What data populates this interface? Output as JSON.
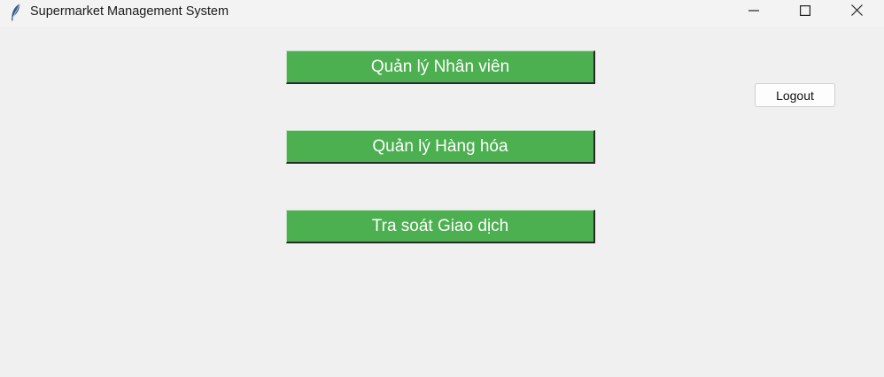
{
  "window": {
    "title": "Supermarket Management System",
    "app_icon": "feather-icon",
    "controls": [
      "minimize-icon",
      "maximize-icon",
      "close-icon"
    ]
  },
  "main": {
    "buttons": [
      {
        "label": "Quản lý Nhân viên"
      },
      {
        "label": "Quản lý Hàng hóa"
      },
      {
        "label": "Tra soát Giao dịch"
      }
    ],
    "logout_label": "Logout"
  },
  "colors": {
    "button_green": "#4caf50",
    "button_text": "#ffffff",
    "background": "#f0f0f0"
  }
}
